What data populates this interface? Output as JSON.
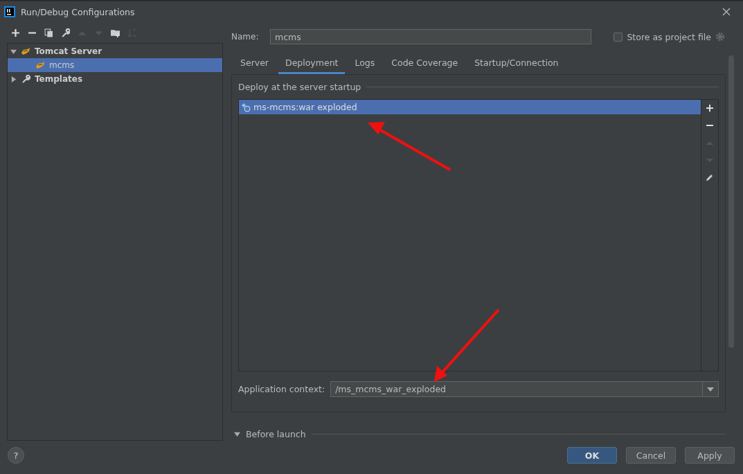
{
  "window": {
    "title": "Run/Debug Configurations"
  },
  "tree": [
    {
      "label": "Tomcat Server",
      "kind": "server",
      "expanded": true,
      "selected": false,
      "children": [
        {
          "label": "mcms",
          "kind": "server",
          "selected": true
        }
      ]
    },
    {
      "label": "Templates",
      "kind": "templates",
      "expanded": false,
      "selected": false
    }
  ],
  "name_field": {
    "label": "Name:",
    "value": "mcms"
  },
  "store_as_project_file": {
    "label": "Store as project file",
    "checked": false
  },
  "tabs": [
    {
      "label": "Server",
      "selected": false
    },
    {
      "label": "Deployment",
      "selected": true
    },
    {
      "label": "Logs",
      "selected": false
    },
    {
      "label": "Code Coverage",
      "selected": false
    },
    {
      "label": "Startup/Connection",
      "selected": false
    }
  ],
  "deploy_section": {
    "title": "Deploy at the server startup",
    "artifacts": [
      {
        "label": "ms-mcms:war exploded",
        "selected": true
      }
    ]
  },
  "application_context": {
    "label": "Application context:",
    "value": "/ms_mcms_war_exploded"
  },
  "before_launch": {
    "label": "Before launch",
    "expanded": true
  },
  "buttons": [
    {
      "label": "OK",
      "primary": true
    },
    {
      "label": "Cancel",
      "primary": false
    },
    {
      "label": "Apply",
      "primary": false
    }
  ],
  "help": {
    "label": "?"
  }
}
